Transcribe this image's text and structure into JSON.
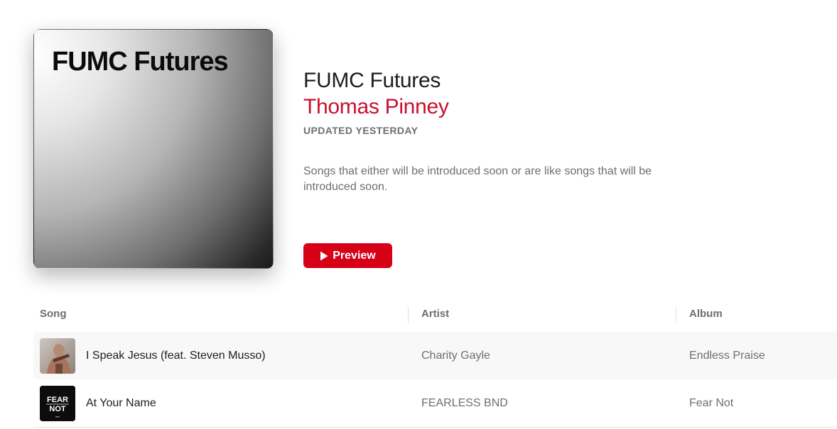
{
  "artwork": {
    "title": "FUMC Futures"
  },
  "playlist": {
    "title": "FUMC Futures",
    "owner": "Thomas Pinney",
    "updated": "UPDATED YESTERDAY",
    "description": "Songs that either will be introduced soon or are like songs that will be introduced soon.",
    "preview_label": "Preview"
  },
  "colors": {
    "accent": "#d60017",
    "owner": "#c8102e",
    "secondary_text": "#6e6e73"
  },
  "table": {
    "columns": [
      "Song",
      "Artist",
      "Album"
    ],
    "rows": [
      {
        "song": "I Speak Jesus (feat. Steven Musso)",
        "artist": "Charity Gayle",
        "album": "Endless Praise",
        "art_icon": "album-art-photo"
      },
      {
        "song": "At Your Name",
        "artist": "FEARLESS BND",
        "album": "Fear Not",
        "art_icon": "album-art-fear-not",
        "art_text_top": "FEAR",
        "art_text_bottom": "NOT"
      }
    ]
  }
}
